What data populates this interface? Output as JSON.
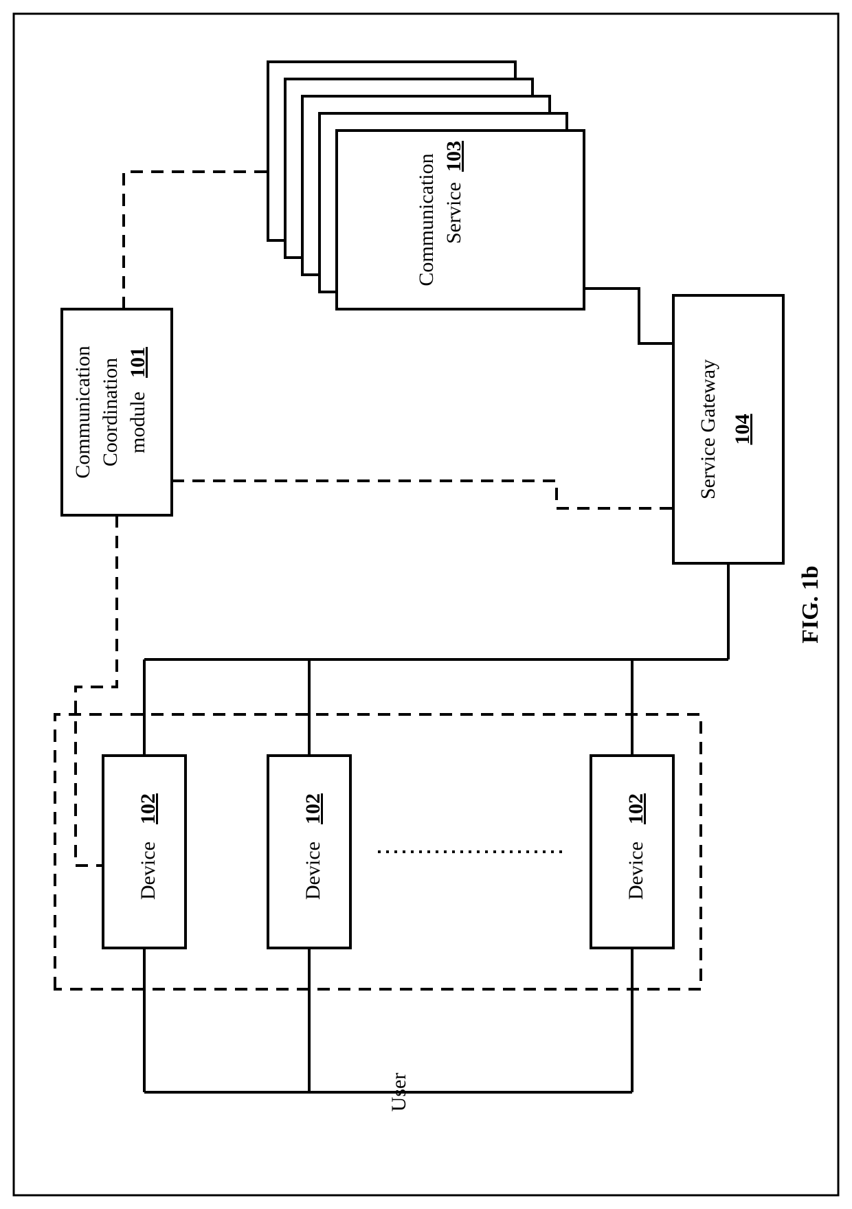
{
  "figure_label": "FIG. 1b",
  "user_label": "User",
  "coord_module": {
    "line1": "Communication",
    "line2": "Coordination",
    "line3": "module",
    "ref": "101"
  },
  "device": {
    "label": "Device",
    "ref": "102"
  },
  "comm_service": {
    "line1": "Communication",
    "line2": "Service",
    "ref": "103"
  },
  "gateway": {
    "label": "Service Gateway",
    "ref": "104"
  }
}
